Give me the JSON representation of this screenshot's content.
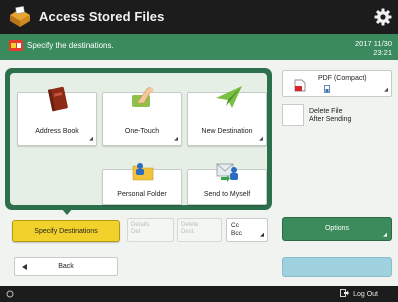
{
  "header": {
    "title": "Access Stored Files"
  },
  "status": {
    "message": "Specify the destinations.",
    "date": "2017 11/30",
    "time": "23:21"
  },
  "destinations": {
    "address_book": "Address Book",
    "one_touch": "One-Touch",
    "new_destination": "New Destination",
    "personal_folder": "Personal Folder",
    "send_to_myself": "Send to Myself"
  },
  "file_format": {
    "label": "PDF (Compact)"
  },
  "delete_after_sending": {
    "label_line1": "Delete File",
    "label_line2": "After Sending"
  },
  "buttons": {
    "specify_destinations": "Specify Destinations",
    "details_line1": "Details",
    "details_line2": "Det",
    "delete_line1": "Delete",
    "delete_line2": "Dest.",
    "cc_line1": "Cc",
    "cc_line2": "Bcc",
    "options": "Options",
    "back": "Back"
  },
  "footer": {
    "logout": "Log Out"
  },
  "colors": {
    "accent_green": "#3a8a5e",
    "panel_green": "#2c6f4c",
    "specify_yellow": "#f2d22a",
    "start_blue": "#9fd2de"
  }
}
